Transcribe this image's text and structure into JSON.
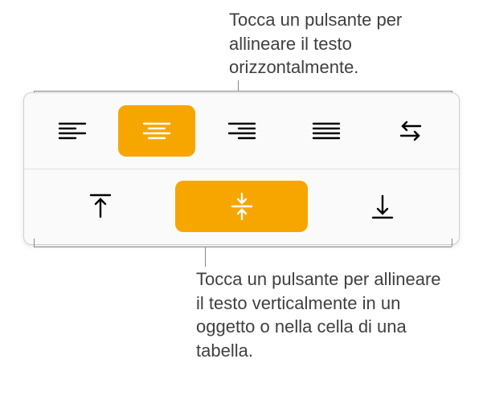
{
  "callouts": {
    "top": "Tocca un pulsante per allineare il testo orizzontalmente.",
    "bottom": "Tocca un pulsante per allineare il testo verticalmente in un oggetto o nella cella di una tabella."
  },
  "panel": {
    "horizontal": {
      "selected_index": 1,
      "buttons": [
        {
          "name": "align-left-button",
          "icon": "align-left-icon"
        },
        {
          "name": "align-center-button",
          "icon": "align-center-icon"
        },
        {
          "name": "align-right-button",
          "icon": "align-right-icon"
        },
        {
          "name": "align-justify-button",
          "icon": "align-justify-icon"
        },
        {
          "name": "text-direction-button",
          "icon": "text-direction-icon"
        }
      ]
    },
    "vertical": {
      "selected_index": 1,
      "buttons": [
        {
          "name": "align-top-button",
          "icon": "align-top-icon"
        },
        {
          "name": "align-middle-button",
          "icon": "align-middle-icon"
        },
        {
          "name": "align-bottom-button",
          "icon": "align-bottom-icon"
        }
      ]
    }
  },
  "colors": {
    "accent": "#f7a600",
    "panel_bg": "#fafafa",
    "panel_border": "#cfcfcf",
    "text": "#3f3f3f"
  }
}
